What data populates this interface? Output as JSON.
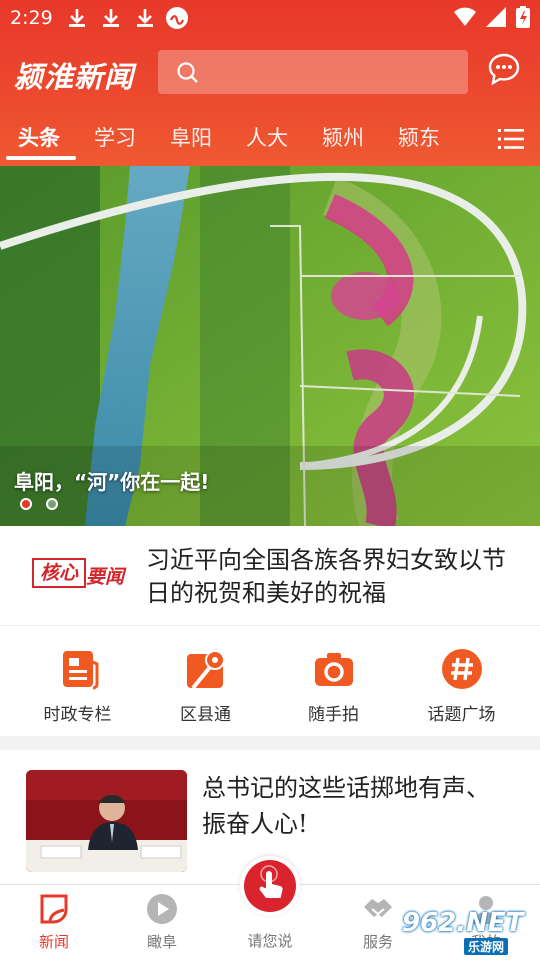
{
  "status_bar": {
    "time": "2:29"
  },
  "header": {
    "logo_text": "颍淮新闻",
    "search_placeholder": ""
  },
  "tabs": [
    {
      "label": "头条",
      "active": true
    },
    {
      "label": "学习"
    },
    {
      "label": "阜阳"
    },
    {
      "label": "人大"
    },
    {
      "label": "颍州"
    },
    {
      "label": "颍东"
    }
  ],
  "banner": {
    "caption": "阜阳，“河”你在一起!",
    "slide_count": 2,
    "active_slide": 1
  },
  "core_news": {
    "badge_box": "核心",
    "badge_text": "要闻",
    "title": "习近平向全国各族各界妇女致以节日的祝贺和美好的祝福"
  },
  "quick_entries": [
    {
      "label": "时政专栏",
      "icon": "document-icon"
    },
    {
      "label": "区县通",
      "icon": "map-pin-icon"
    },
    {
      "label": "随手拍",
      "icon": "camera-icon"
    },
    {
      "label": "话题广场",
      "icon": "hashtag-icon"
    }
  ],
  "news_list": [
    {
      "title": "总书记的这些话掷地有声、振奋人心!"
    }
  ],
  "bottom_nav": {
    "items": [
      {
        "label": "新闻",
        "active": true
      },
      {
        "label": "瞰阜"
      },
      {
        "label": "请您说"
      },
      {
        "label": "服务"
      },
      {
        "label": "我的"
      }
    ]
  },
  "watermark": {
    "text": "962.NET",
    "sub": "乐游网"
  },
  "colors": {
    "brand_red": "#e8382b",
    "accent_orange": "#f05a22"
  }
}
